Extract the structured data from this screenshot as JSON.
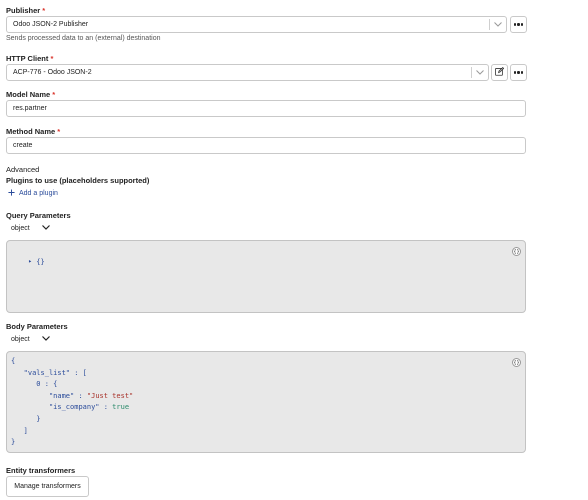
{
  "publisher": {
    "label": "Publisher",
    "required_mark": "*",
    "value": "Odoo JSON-2 Publisher",
    "help": "Sends processed data to an (external) destination"
  },
  "http_client": {
    "label": "HTTP Client",
    "required_mark": "*",
    "value": "ACP-776 - Odoo JSON-2"
  },
  "model_name": {
    "label": "Model Name",
    "required_mark": "*",
    "value": "res.partner"
  },
  "method_name": {
    "label": "Method Name",
    "required_mark": "*",
    "value": "create"
  },
  "advanced": {
    "heading": "Advanced",
    "plugins_label": "Plugins to use (placeholders supported)",
    "add_plugin_label": "Add a plugin"
  },
  "query_parameters": {
    "label": "Query Parameters",
    "type": "object",
    "code_lines": [
      "{}"
    ],
    "badge": "{}"
  },
  "body_parameters": {
    "label": "Body Parameters",
    "type": "object",
    "badge": "{}",
    "lines": {
      "l1": "{",
      "l2_key": "\"vals_list\"",
      "l2_rest": " : [",
      "l3": "0 : {",
      "l4_key": "\"name\"",
      "l4_sep": " : ",
      "l4_val": "\"Just test\"",
      "l5_key": "\"is_company\"",
      "l5_sep": " : ",
      "l5_val": "true",
      "l6": "}",
      "l7": "]",
      "l8": "}"
    }
  },
  "entity_transformers": {
    "label": "Entity transformers",
    "button": "Manage transformers"
  },
  "colors": {
    "accent": "#2a4b9a",
    "editor_bg": "#e8e8e8",
    "string": "#a8322a",
    "boolean": "#2a8a6a"
  }
}
